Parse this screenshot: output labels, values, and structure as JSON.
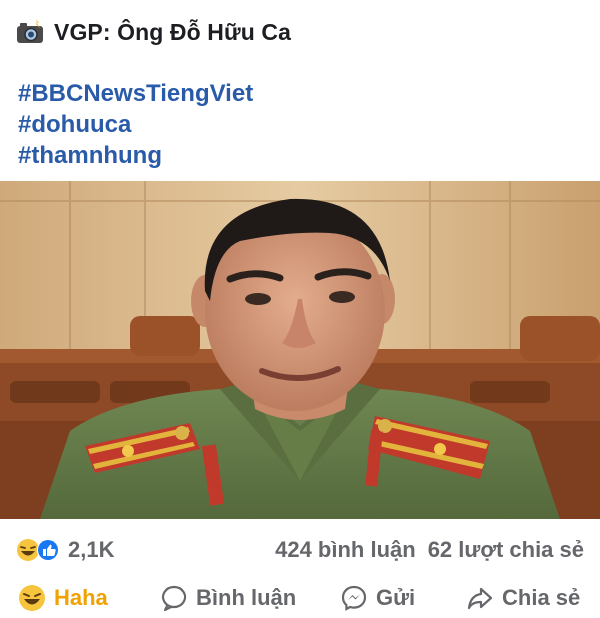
{
  "post": {
    "title": "VGP: Ông Đỗ Hữu Ca",
    "title_icon": "camera-flash-icon",
    "hashtags": [
      "#BBCNewsTiengViet",
      "#dohuuca",
      "#thamnhung"
    ]
  },
  "photo": {
    "subject": "photo-portrait-officer-green-uniform"
  },
  "stats": {
    "reactions_icons": [
      "haha-icon",
      "like-icon"
    ],
    "reactions_count": "2,1K",
    "comments": "424 bình luận",
    "shares": "62 lượt chia sẻ"
  },
  "actions": {
    "reaction": "Haha",
    "comment": "Bình luận",
    "send": "Gửi",
    "share": "Chia sẻ"
  },
  "colors": {
    "hashtag": "#2a5ba8",
    "haha_active": "#f0a200",
    "muted_text": "#65676b",
    "like_blue": "#1877f2"
  }
}
